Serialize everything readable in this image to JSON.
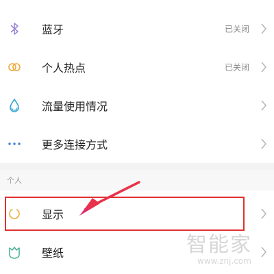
{
  "settings": {
    "rows": [
      {
        "label": "蓝牙",
        "status": "已关闭",
        "icon": "bluetooth-icon"
      },
      {
        "label": "个人热点",
        "status": "已关闭",
        "icon": "hotspot-icon"
      },
      {
        "label": "流量使用情况",
        "status": "",
        "icon": "data-usage-icon"
      },
      {
        "label": "更多连接方式",
        "status": "",
        "icon": "more-connections-icon"
      }
    ],
    "personal_section": {
      "header": "个人",
      "rows": [
        {
          "label": "显示",
          "icon": "display-icon"
        },
        {
          "label": "壁纸",
          "icon": "wallpaper-icon"
        }
      ]
    }
  },
  "annotation": {
    "highlight_color": "#e0312f",
    "arrow_color": "#e8334a"
  },
  "watermark": {
    "text": "智能家",
    "url": "www.znj.com"
  },
  "colors": {
    "bluetooth": "#9b86d6",
    "hotspot": "#f0a93c",
    "data_usage": "#3aa7d6",
    "more": "#3a7fd6",
    "display": "#f0a93c",
    "wallpaper": "#4cb39a"
  }
}
